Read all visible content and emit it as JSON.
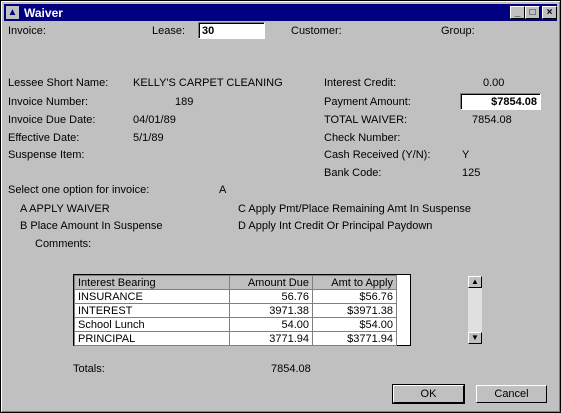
{
  "window": {
    "title": "Waiver"
  },
  "header": {
    "invoice_label": "Invoice:",
    "lease_label": "Lease:",
    "lease_value": "30",
    "customer_label": "Customer:",
    "group_label": "Group:"
  },
  "left": {
    "lessee_label": "Lessee Short Name:",
    "lessee_value": "KELLY'S CARPET CLEANING",
    "invoice_number_label": "Invoice Number:",
    "invoice_number_value": "189",
    "invoice_due_label": "Invoice Due Date:",
    "invoice_due_value": "04/01/89",
    "effective_label": "Effective Date:",
    "effective_value": "5/1/89",
    "suspense_label": "Suspense Item:"
  },
  "right": {
    "interest_credit_label": "Interest Credit:",
    "interest_credit_value": "0.00",
    "payment_amount_label": "Payment Amount:",
    "payment_amount_value": "$7854.08",
    "total_waiver_label": "TOTAL WAIVER:",
    "total_waiver_value": "7854.08",
    "check_number_label": "Check Number:",
    "cash_received_label": "Cash Received (Y/N):",
    "cash_received_value": "Y",
    "bank_code_label": "Bank Code:",
    "bank_code_value": "125"
  },
  "options": {
    "prompt": "Select one option for invoice:",
    "selected": "A",
    "a": "A APPLY WAIVER",
    "b": "B  Place Amount In Suspense",
    "c": "C  Apply Pmt/Place Remaining Amt In Suspense",
    "d": "D  Apply Int Credit Or Principal Paydown",
    "comments_label": "Comments:"
  },
  "table": {
    "headers": [
      "Interest Bearing",
      "Amount Due",
      "Amt to Apply"
    ],
    "rows": [
      [
        "INSURANCE",
        "56.76",
        "$56.76"
      ],
      [
        "INTEREST",
        "3971.38",
        "$3971.38"
      ],
      [
        "School Lunch",
        "54.00",
        "$54.00"
      ],
      [
        "PRINCIPAL",
        "3771.94",
        "$3771.94"
      ]
    ]
  },
  "totals": {
    "label": "Totals:",
    "value": "7854.08"
  },
  "buttons": {
    "ok": "OK",
    "cancel": "Cancel"
  }
}
